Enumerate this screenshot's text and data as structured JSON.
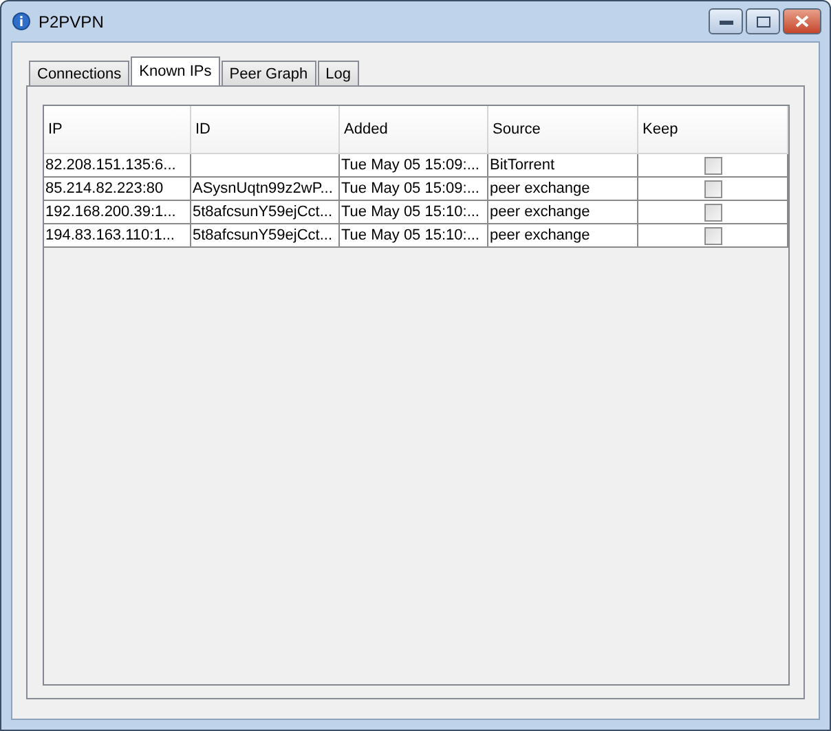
{
  "window": {
    "title": "P2PVPN"
  },
  "tabs": [
    {
      "label": "Connections",
      "selected": false
    },
    {
      "label": "Known IPs",
      "selected": true
    },
    {
      "label": "Peer Graph",
      "selected": false
    },
    {
      "label": "Log",
      "selected": false
    }
  ],
  "table": {
    "columns": [
      "IP",
      "ID",
      "Added",
      "Source",
      "Keep"
    ],
    "rows": [
      {
        "ip": "82.208.151.135:6...",
        "id": "",
        "added": "Tue May 05 15:09:...",
        "source": "BitTorrent",
        "keep": false
      },
      {
        "ip": "85.214.82.223:80",
        "id": "ASysnUqtn99z2wP...",
        "added": "Tue May 05 15:09:...",
        "source": "peer exchange",
        "keep": false
      },
      {
        "ip": "192.168.200.39:1...",
        "id": "5t8afcsunY59ejCct...",
        "added": "Tue May 05 15:10:...",
        "source": "peer exchange",
        "keep": false
      },
      {
        "ip": "194.83.163.110:1...",
        "id": "5t8afcsunY59ejCct...",
        "added": "Tue May 05 15:10:...",
        "source": "peer exchange",
        "keep": false
      }
    ]
  }
}
